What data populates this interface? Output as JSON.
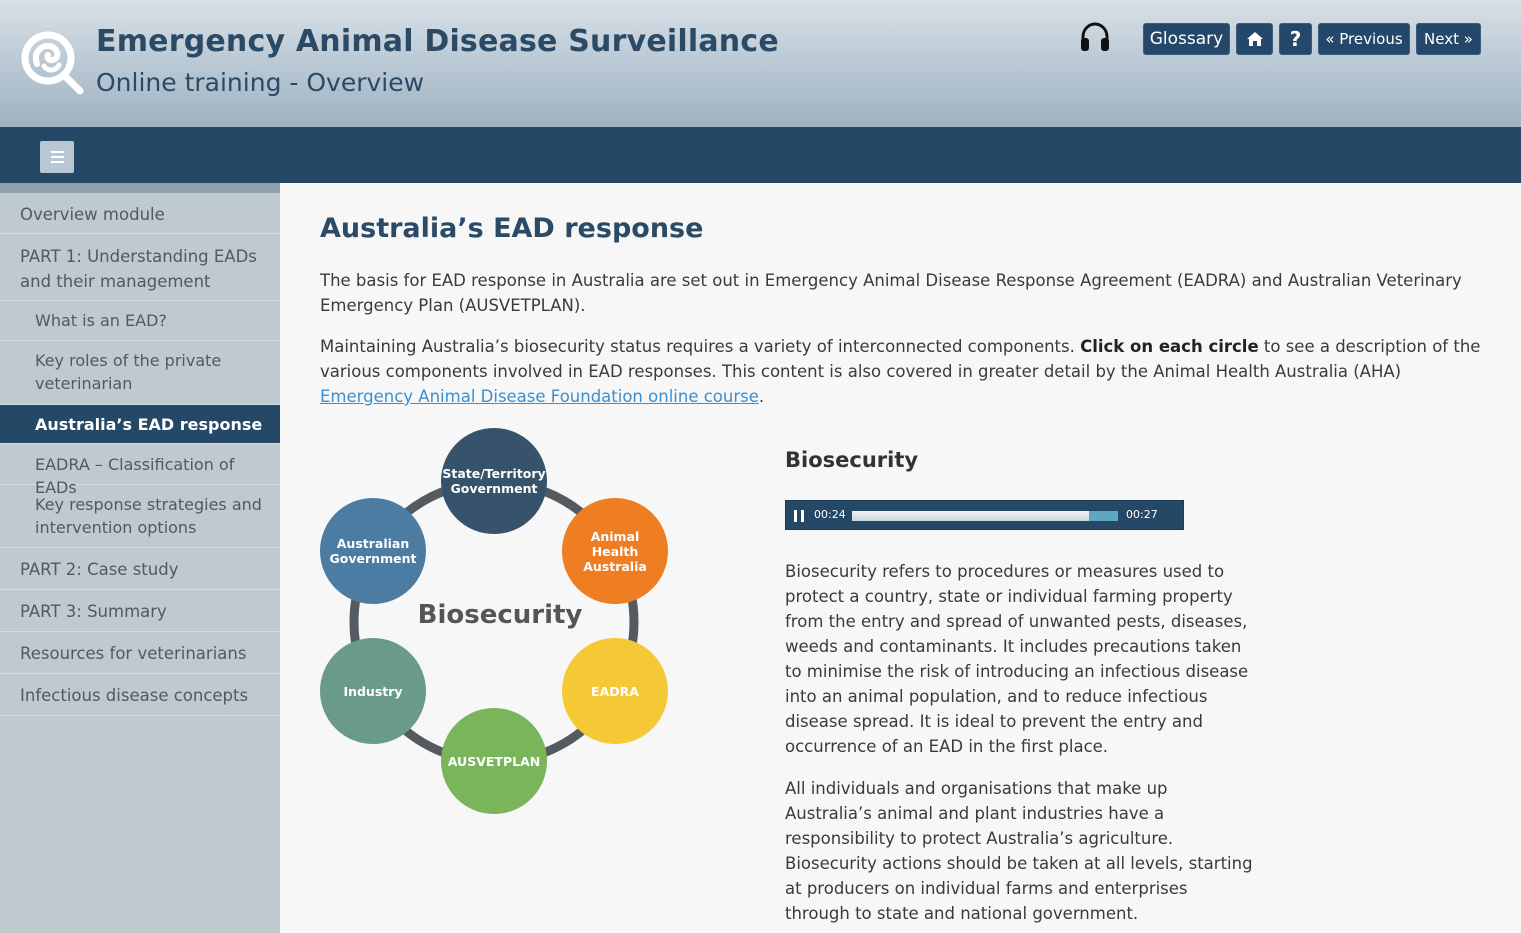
{
  "header": {
    "title": "Emergency Animal Disease Surveillance",
    "subtitle": "Online training - Overview",
    "buttons": {
      "glossary": "Glossary",
      "previous": "« Previous",
      "next": "Next »"
    }
  },
  "sidebar": {
    "items": [
      {
        "label": "Overview module"
      },
      {
        "label": "PART 1: Understanding EADs and their management"
      },
      {
        "label": "What is an EAD?"
      },
      {
        "label": "Key roles of the private veterinarian"
      },
      {
        "label": "Australia’s EAD response"
      },
      {
        "label": "EADRA – Classification of EADs"
      },
      {
        "label": "Key response strategies and intervention options"
      },
      {
        "label": "PART 2: Case study"
      },
      {
        "label": "PART 3: Summary"
      },
      {
        "label": "Resources for veterinarians"
      },
      {
        "label": "Infectious disease concepts"
      }
    ]
  },
  "main": {
    "title": "Australia’s EAD response",
    "para1": "The basis for EAD response in Australia are set out in Emergency Animal Disease Response Agreement (EADRA) and Australian Veterinary Emergency Plan (AUSVETPLAN).",
    "para2_start": "Maintaining Australia’s biosecurity status requires a variety of interconnected components. ",
    "para2_bold": "Click on each circle",
    "para2_mid": " to see a description of the various components involved in EAD responses. This content is also covered in greater detail by the Animal Health Australia (AHA) ",
    "para2_link": "Emergency Animal Disease Foundation online course",
    "para2_end": "."
  },
  "diagram": {
    "center": "Biosecurity",
    "circles": {
      "state": "State/Territory Government",
      "aha": "Animal Health Australia",
      "eadra": "EADRA",
      "ausvetplan": "AUSVETPLAN",
      "industry": "Industry",
      "ausgov": "Australian Government"
    }
  },
  "panel": {
    "title": "Biosecurity",
    "player": {
      "current": "00:24",
      "duration": "00:27",
      "progress": 0.89
    },
    "p1": "Biosecurity refers to procedures or measures used to protect a country, state or individual farming property from the entry and spread of unwanted pests, diseases, weeds and contaminants. It includes precautions taken to minimise the risk of introducing an infectious disease into an animal population, and to reduce infectious disease spread. It is ideal to prevent the entry and occurrence of an EAD in the first place.",
    "p2": "All individuals and organisations that make up Australia’s animal and plant industries have a responsibility to protect Australia’s agriculture. Biosecurity actions should be taken at all levels, starting at producers on individual farms and enterprises through to state and national government."
  },
  "icons": {
    "logo": "magnifier-logo-icon",
    "audio": "headphones-icon",
    "home": "home-icon",
    "help": "question-icon",
    "menu": "hamburger-menu-icon",
    "pause": "pause-icon"
  },
  "colors": {
    "navy": "#264867",
    "state": "#37536b",
    "aha": "#ef7d22",
    "eadra": "#f5c935",
    "ausvetplan": "#7ab55c",
    "industry": "#6a9a88",
    "ausgov": "#4d7ca2"
  }
}
